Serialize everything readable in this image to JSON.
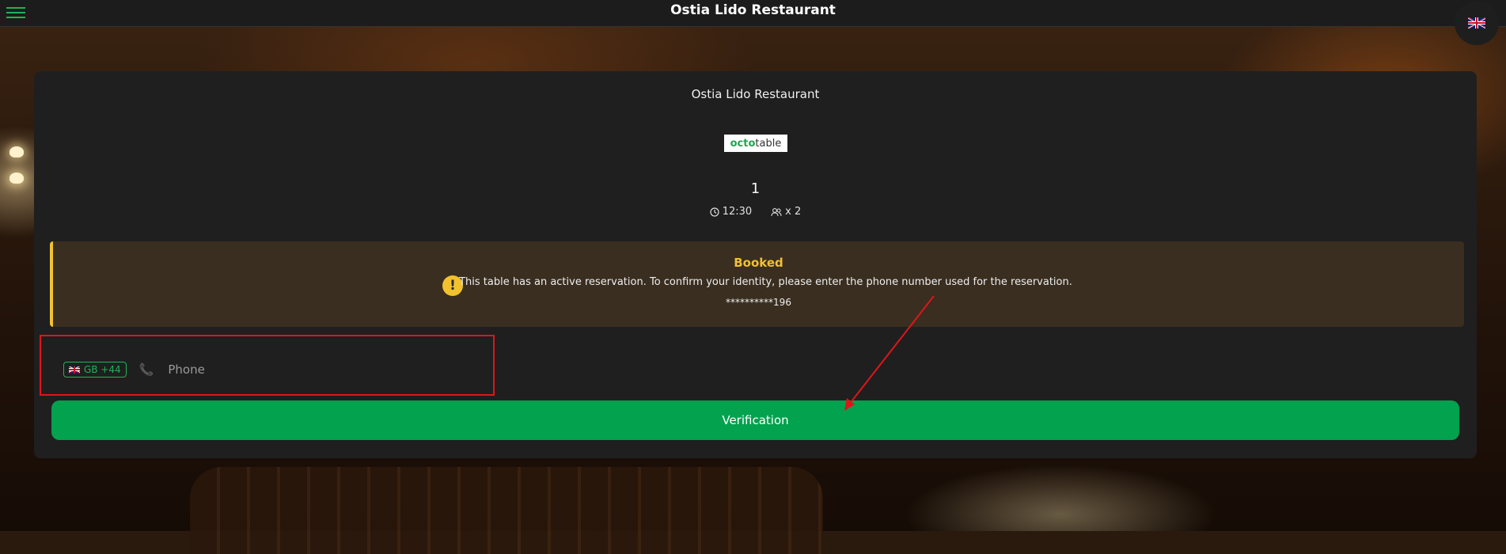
{
  "header": {
    "app_title": "Ostia Lido Restaurant",
    "menu_icon": "hamburger-menu-icon",
    "language_flag": "uk-flag-icon"
  },
  "card": {
    "restaurant_name": "Ostia Lido Restaurant",
    "logo_text_octo": "octo",
    "logo_text_table": "table",
    "table_number": "1",
    "time": "12:30",
    "guests": "x 2"
  },
  "alert": {
    "title": "Booked",
    "icon": "!",
    "message": "This table has an active reservation. To confirm your identity, please enter the phone number used for the reservation.",
    "masked_phone": "**********196",
    "accent_color": "#f2c12e"
  },
  "phone": {
    "country_code": "GB +44",
    "placeholder": "Phone",
    "country_flag": "uk-flag-icon"
  },
  "verify_button": {
    "label": "Verification",
    "color": "#02a24f"
  },
  "annotation": {
    "highlight_color": "#e0151a"
  }
}
